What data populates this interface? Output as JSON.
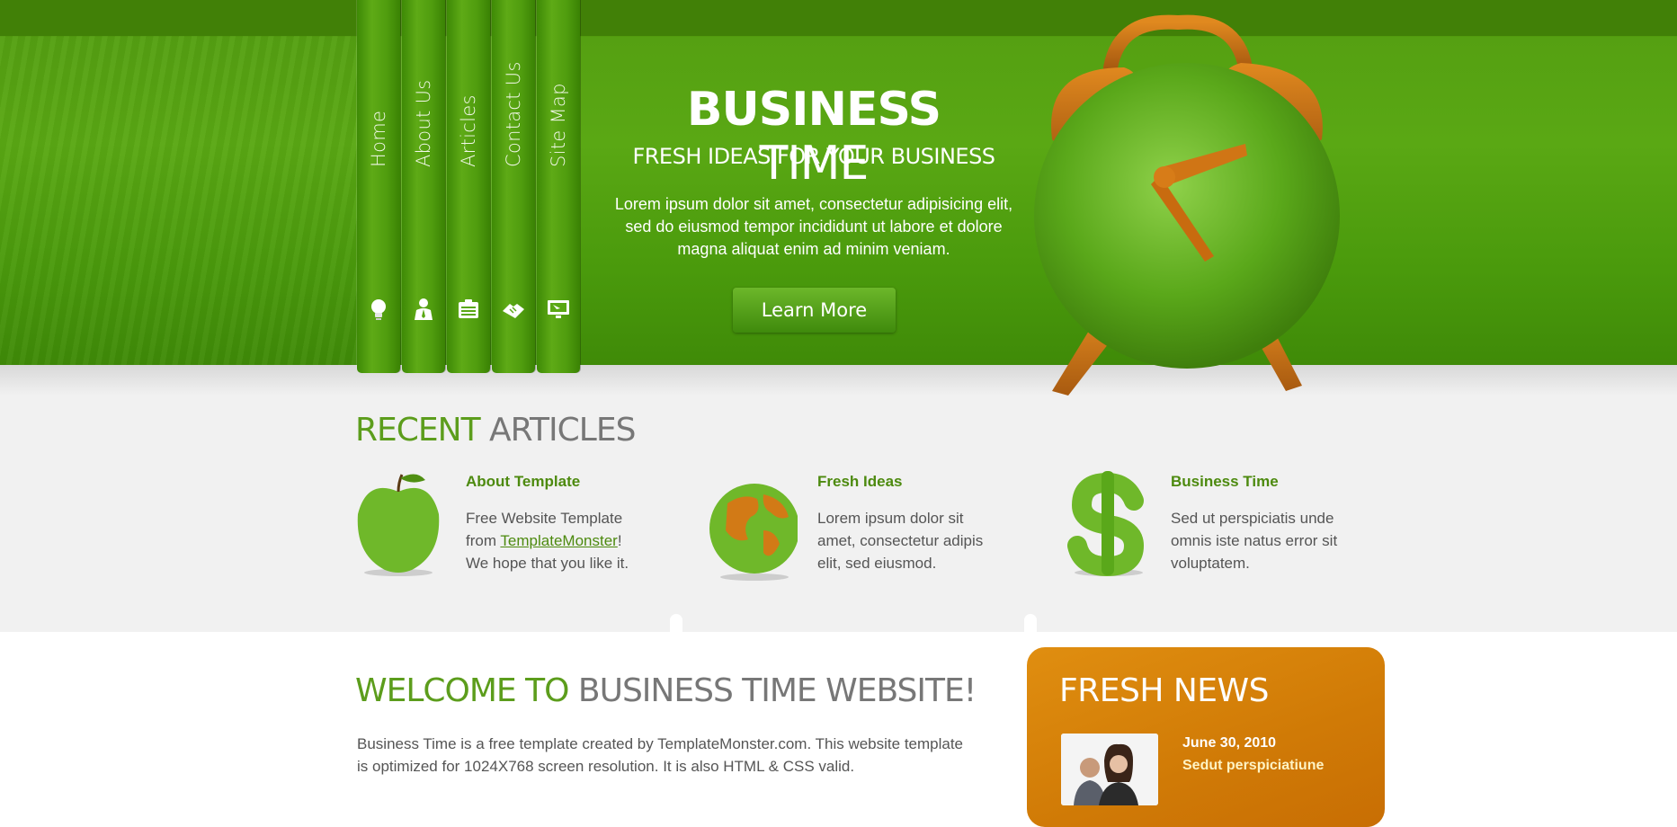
{
  "nav": {
    "items": [
      {
        "label": "Home",
        "icon": "lightbulb-icon"
      },
      {
        "label": "About Us",
        "icon": "person-icon"
      },
      {
        "label": "Articles",
        "icon": "clipboard-icon"
      },
      {
        "label": "Contact Us",
        "icon": "handshake-icon"
      },
      {
        "label": "Site Map",
        "icon": "monitor-icon"
      }
    ]
  },
  "hero": {
    "title_bold": "BUSINESS",
    "title_light": "TIME",
    "subtitle": "FRESH IDEAS FOR YOUR BUSINESS",
    "text": "Lorem ipsum dolor sit amet, consectetur adipisicing elit, sed do eiusmod tempor incididunt ut labore et dolore magna aliquat enim ad minim veniam.",
    "button": "Learn More"
  },
  "recent": {
    "title_green": "RECENT",
    "title_gray": "ARTICLES",
    "items": [
      {
        "heading": "About Template",
        "text_before": "Free Website Template from ",
        "link": "TemplateMonster",
        "text_after": "! We hope that you like it.",
        "icon": "grass-apple-icon"
      },
      {
        "heading": "Fresh Ideas",
        "text": "Lorem ipsum dolor sit amet, consectetur adipis elit, sed eiusmod.",
        "icon": "grass-globe-icon"
      },
      {
        "heading": "Business Time",
        "text": "Sed ut perspiciatis unde omnis iste natus error sit voluptatem.",
        "icon": "grass-dollar-icon"
      }
    ]
  },
  "welcome": {
    "title_green": "WELCOME TO",
    "title_gray": "BUSINESS TIME WEBSITE!",
    "text": "Business Time is a free template created by TemplateMonster.com. This website template is optimized for 1024X768 screen resolution. It is also HTML & CSS valid."
  },
  "news": {
    "title": "FRESH NEWS",
    "date": "June 30, 2010",
    "headline": "Sedut perspiciatiune"
  },
  "colors": {
    "header_green": "#4f960b",
    "accent_green": "#5c9d1c",
    "news_orange": "#d87f0a"
  }
}
